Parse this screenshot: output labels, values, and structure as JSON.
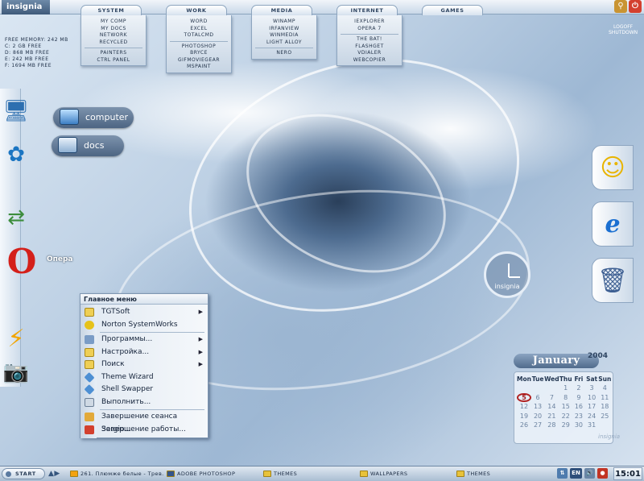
{
  "topbar": {
    "brand": "insignia",
    "tabs": [
      "SYSTEM",
      "WORK",
      "MEDIA",
      "INTERNET",
      "GAMES"
    ],
    "menus": {
      "system": [
        "MY COMP",
        "MY DOCS",
        "NETWORK",
        "RECYCLED",
        "",
        "PAINTERS",
        "CTRL PANEL"
      ],
      "work": [
        "WORD",
        "EXCEL",
        "TOTALCMD",
        "",
        "PHOTOSHOP",
        "BRYCE",
        "GIFMOVIEGEAR",
        "MSPAINT"
      ],
      "media": [
        "WINAMP",
        "IRFANVIEW",
        "WINMEDIA",
        "LIGHT ALLOY",
        "",
        "NERO"
      ],
      "internet": [
        "IEXPLORER",
        "OPERA 7",
        "",
        "THE BAT!",
        "FLASHGET",
        "VDIALER",
        "WEBCOPIER"
      ]
    },
    "logoff_label": "LOGOFF",
    "shutdown_label": "SHUTDOWN"
  },
  "free_memory": [
    "FREE MEMORY: 242 MB",
    "C: 2 GB FREE",
    "D: 868 MB FREE",
    "E: 242 MB FREE",
    "F: 1694 MB FREE"
  ],
  "shortcuts": {
    "computer": "computer",
    "docs": "docs",
    "opera": "Опера"
  },
  "clock_widget": {
    "label": "insignia"
  },
  "calendar": {
    "month": "January",
    "year": "2004",
    "weekdays": [
      "Mon",
      "Tue",
      "Wed",
      "Thu",
      "Fri",
      "Sat",
      "Sun"
    ],
    "weeks": [
      [
        "",
        "",
        "",
        "1",
        "2",
        "3",
        "4"
      ],
      [
        "5",
        "6",
        "7",
        "8",
        "9",
        "10",
        "11"
      ],
      [
        "12",
        "13",
        "14",
        "15",
        "16",
        "17",
        "18"
      ],
      [
        "19",
        "20",
        "21",
        "22",
        "23",
        "24",
        "25"
      ],
      [
        "26",
        "27",
        "28",
        "29",
        "30",
        "31",
        ""
      ]
    ],
    "today": "5",
    "brand": "insignia"
  },
  "start_menu": {
    "title": "Главное меню",
    "items": [
      {
        "label": "TGTSoft",
        "submenu": true
      },
      {
        "label": "Norton SystemWorks",
        "submenu": false
      },
      {
        "label": "Программы...",
        "submenu": true
      },
      {
        "label": "Настройка...",
        "submenu": true
      },
      {
        "label": "Поиск",
        "submenu": true
      },
      {
        "label": "Theme Wizard",
        "submenu": false
      },
      {
        "label": "Shell Swapper",
        "submenu": false
      },
      {
        "label": "Выполнить...",
        "submenu": false
      },
      {
        "label": "Завершение сеанса Sergio...",
        "submenu": false
      },
      {
        "label": "Завершение работы...",
        "submenu": false
      }
    ]
  },
  "taskbar": {
    "start_label": "START",
    "tasks": [
      "261. Плюмже белые - Трев...",
      "ADOBE PHOTOSHOP",
      "THEMES",
      "WALLPAPERS",
      "THEMES"
    ],
    "tray_lang": "EN",
    "time": "15:01"
  },
  "colors": {
    "accent": "#4d6583",
    "panel": "#dbe6f1",
    "today_ring": "#b02222"
  }
}
